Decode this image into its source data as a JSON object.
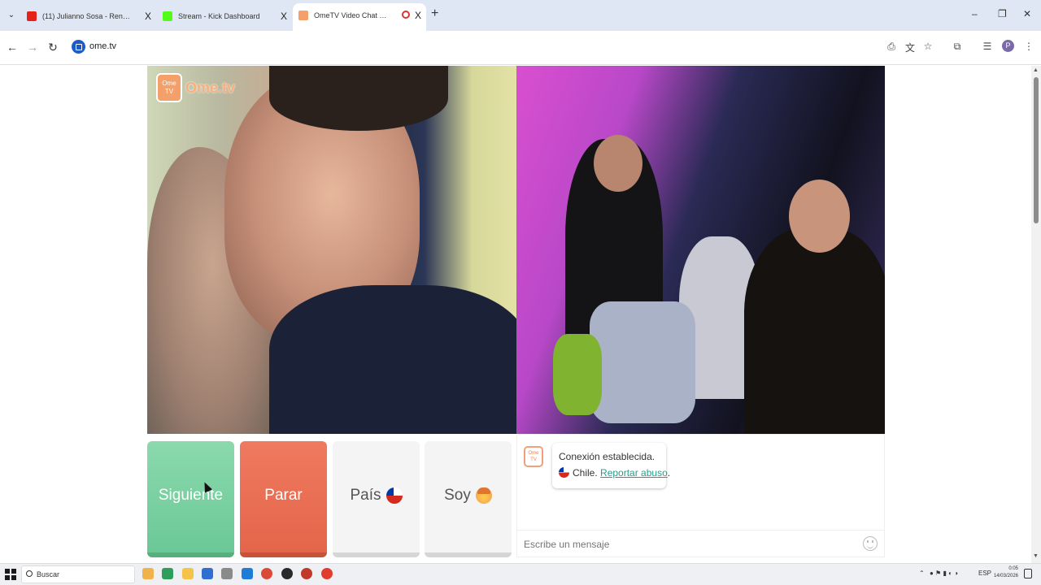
{
  "browser": {
    "tabs": [
      {
        "title": "(11) Julianno Sosa - Rendido (Video Ofi...",
        "favicon_color": "#e62117"
      },
      {
        "title": "Stream - Kick Dashboard",
        "favicon_color": "#53fc18"
      },
      {
        "title": "OmeTV Video Chat — Omegle Rand...",
        "favicon_color": "#f3a06a"
      }
    ],
    "new_tab": "+",
    "close_glyph": "X",
    "window_controls": {
      "minimize": "–",
      "restore": "❐",
      "close": "✕"
    },
    "nav": {
      "back": "←",
      "forward": "→",
      "reload": "↻"
    },
    "url": "ome.tv",
    "profile_initial": "P"
  },
  "logo": {
    "badge": "Ome TV",
    "text": "Ome.tv"
  },
  "controls": {
    "next_label": "Siguiente",
    "stop_label": "Parar",
    "country_label": "País",
    "me_label": "Soy"
  },
  "chat": {
    "avatar_text": "Ome TV",
    "status": "Conexión establecida.",
    "country": "Chile.",
    "report_link": "Reportar abuso",
    "report_suffix": ".",
    "input_placeholder": "Escribe un mensaje"
  },
  "taskbar": {
    "search_placeholder": "Buscar",
    "apps": [
      "#f0b24a",
      "#2f9e5a",
      "#f3c34a",
      "#2f6fd1",
      "#8a8a8a",
      "#1e7bd6",
      "#d94a38",
      "#2a2a2a",
      "#c0392b",
      "#e23c30"
    ],
    "tray_lang": "ESP",
    "clock_time": "0:05",
    "clock_date": "14/03/2026"
  }
}
